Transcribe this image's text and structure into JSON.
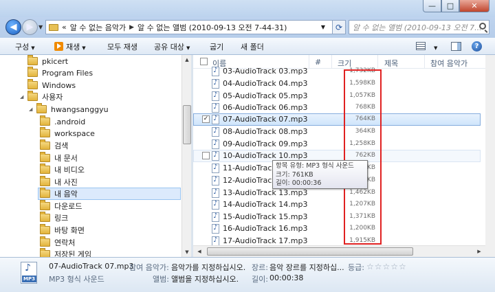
{
  "window": {
    "controls": {
      "minimize": "—",
      "maximize": "□",
      "close": "✕"
    }
  },
  "address": {
    "prefix": "«",
    "crumbs": [
      "알 수 없는 음악가",
      "알 수 없는 앨범 (2010-09-13 오전 7-44-31)"
    ],
    "search_placeholder": "알 수 없는 앨범 (2010-09-13 오전 7..."
  },
  "toolbar": {
    "organize": "구성",
    "play": "재생",
    "play_all": "모두 재생",
    "share": "공유 대상",
    "burn": "굽기",
    "new_folder": "새 폴더"
  },
  "nav_tree": [
    {
      "label": "pkicert"
    },
    {
      "label": "Program Files"
    },
    {
      "label": "Windows"
    },
    {
      "label": "사용자"
    },
    {
      "label": "hwangsanggyu"
    },
    {
      "label": ".android"
    },
    {
      "label": "workspace"
    },
    {
      "label": "검색"
    },
    {
      "label": "내 문서"
    },
    {
      "label": "내 비디오"
    },
    {
      "label": "내 사진"
    },
    {
      "label": "내 음악"
    },
    {
      "label": "다운로드"
    },
    {
      "label": "링크"
    },
    {
      "label": "바탕 화면"
    },
    {
      "label": "연락처"
    },
    {
      "label": "저장된 게임"
    }
  ],
  "columns": {
    "name": "이름",
    "number": "#",
    "size": "크기",
    "title": "제목",
    "artist": "참여 음악가"
  },
  "files": [
    {
      "name": "03-AudioTrack 03.mp3",
      "size": "1,732KB"
    },
    {
      "name": "04-AudioTrack 04.mp3",
      "size": "1,598KB"
    },
    {
      "name": "05-AudioTrack 05.mp3",
      "size": "1,057KB"
    },
    {
      "name": "06-AudioTrack 06.mp3",
      "size": "768KB"
    },
    {
      "name": "07-AudioTrack 07.mp3",
      "size": "764KB",
      "checked": "✓"
    },
    {
      "name": "08-AudioTrack 08.mp3",
      "size": "364KB"
    },
    {
      "name": "09-AudioTrack 09.mp3",
      "size": "1,258KB"
    },
    {
      "name": "10-AudioTrack 10.mp3",
      "size": "762KB"
    },
    {
      "name": "11-AudioTrack 11.mp3",
      "size": "1,555KB"
    },
    {
      "name": "12-AudioTrack 12.mp3",
      "size": "1,462KB"
    },
    {
      "name": "13-AudioTrack 13.mp3",
      "size": "1,462KB"
    },
    {
      "name": "14-AudioTrack 14.mp3",
      "size": "1,207KB"
    },
    {
      "name": "15-AudioTrack 15.mp3",
      "size": "1,371KB"
    },
    {
      "name": "16-AudioTrack 16.mp3",
      "size": "1,200KB"
    },
    {
      "name": "17-AudioTrack 17.mp3",
      "size": "1,915KB"
    }
  ],
  "tooltip": {
    "type": "항목 유형: MP3 형식 사운드",
    "size": "크기: 761KB",
    "length": "길이: 00:00:36"
  },
  "details": {
    "icon_label": "MP3",
    "filename": "07-AudioTrack 07.mp3",
    "filetype": "MP3 형식 사운드",
    "artist_label": "참여 음악가:",
    "artist_value": "음악가를 지정하십시오.",
    "genre_label": "장르:",
    "genre_value": "음악 장르를 지정하십...",
    "rating_label": "등급:",
    "rating_stars": "☆☆☆☆☆",
    "album_label": "앨범:",
    "album_value": "앨범을 지정하십시오.",
    "length_label": "길이:",
    "length_value": "00:00:38"
  }
}
